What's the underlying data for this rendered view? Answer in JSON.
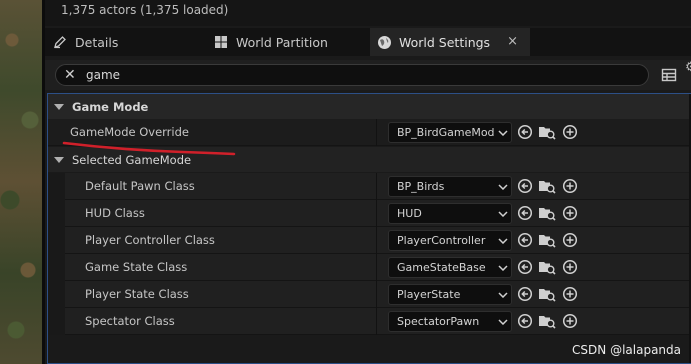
{
  "actor_count": "1,375 actors (1,375 loaded)",
  "tabs": [
    {
      "label": "Details",
      "icon": "pencil-icon"
    },
    {
      "label": "World Partition",
      "icon": "partition-grid-icon"
    },
    {
      "label": "World Settings",
      "icon": "globe-icon",
      "active": true,
      "close": "×"
    }
  ],
  "search": {
    "value": "game",
    "clear_glyph": "✕"
  },
  "categories": {
    "game_mode": "Game Mode",
    "selected_game_mode": "Selected GameMode"
  },
  "game_mode_override": {
    "label": "GameMode Override",
    "value": "BP_BirdGameMod"
  },
  "selected_rows": [
    {
      "label": "Default Pawn Class",
      "value": "BP_Birds"
    },
    {
      "label": "HUD Class",
      "value": "HUD"
    },
    {
      "label": "Player Controller Class",
      "value": "PlayerController"
    },
    {
      "label": "Game State Class",
      "value": "GameStateBase"
    },
    {
      "label": "Player State Class",
      "value": "PlayerState"
    },
    {
      "label": "Spectator Class",
      "value": "SpectatorPawn"
    }
  ],
  "annotation_color": "#d0202a",
  "accent_color": "#2c4f86",
  "watermark": "CSDN @lalapanda"
}
